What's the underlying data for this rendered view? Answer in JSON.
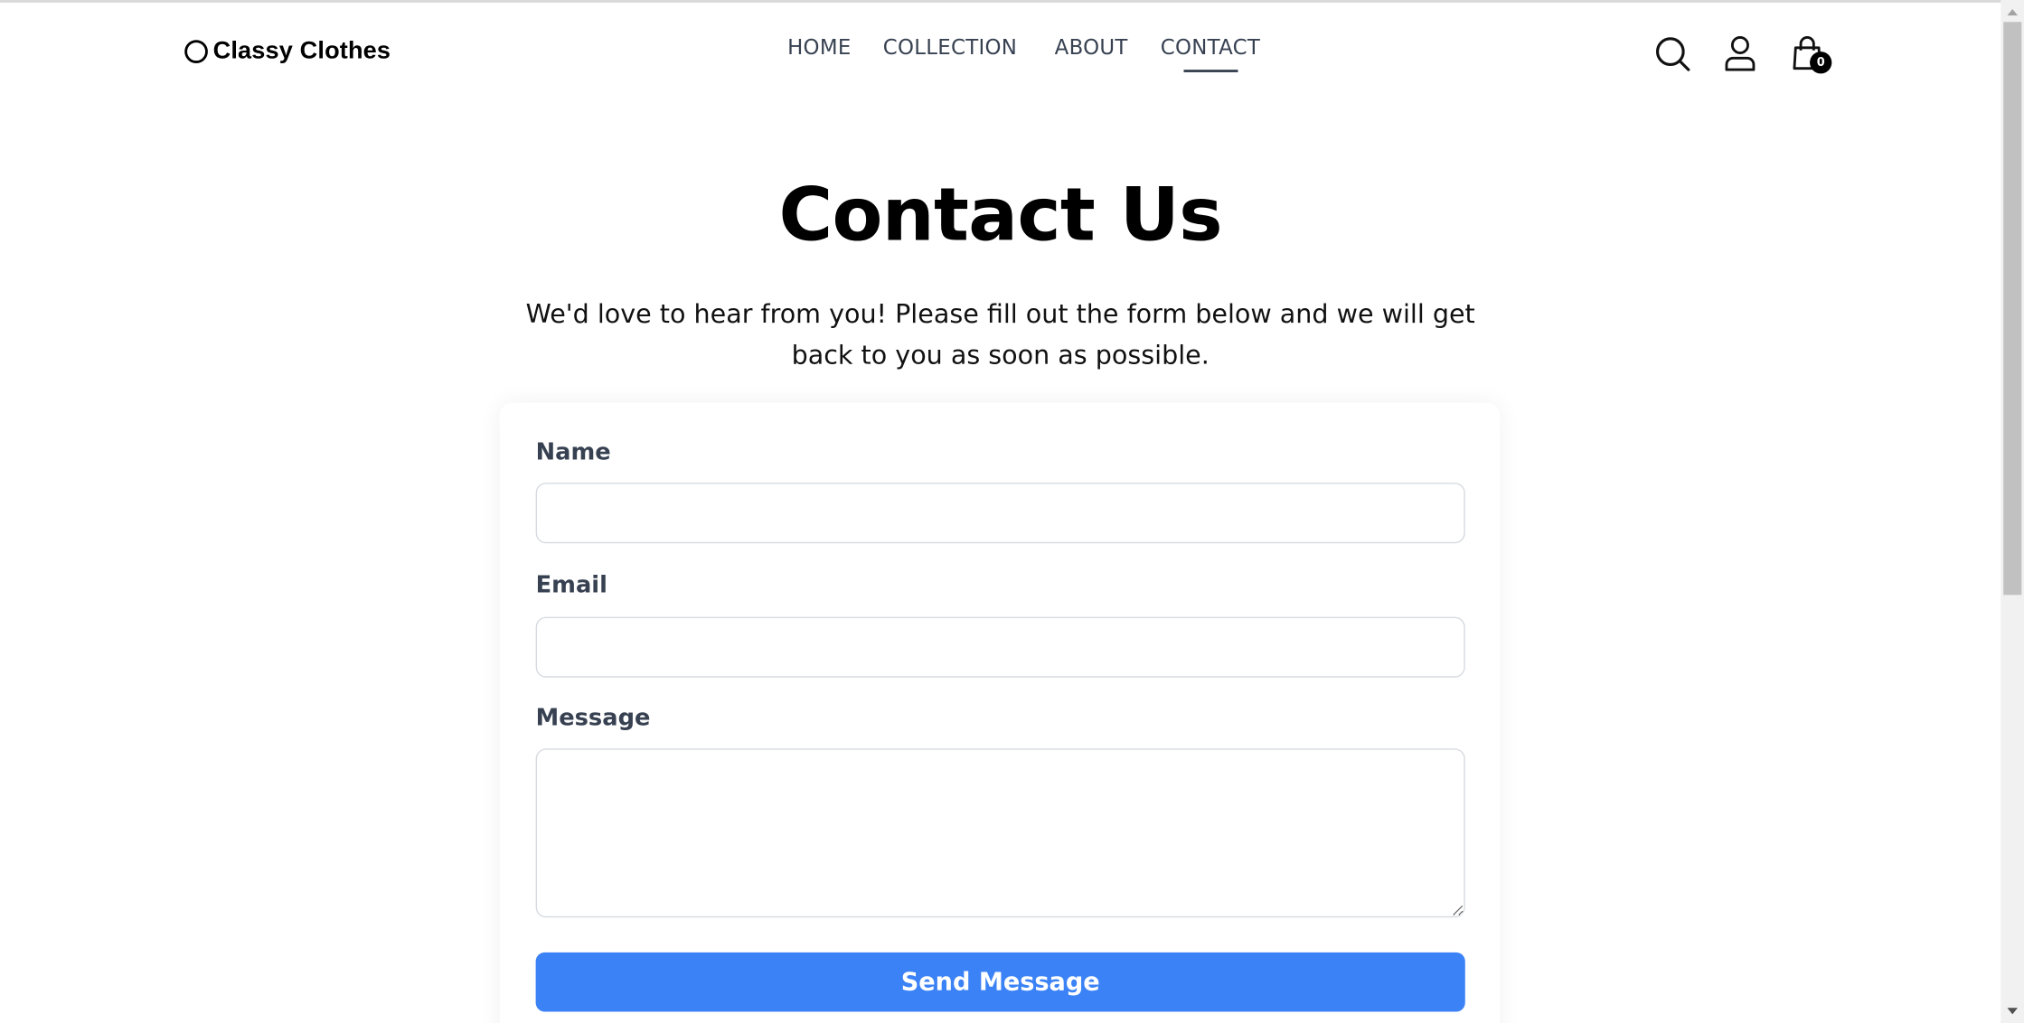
{
  "brand": {
    "name": "Classy Clothes"
  },
  "nav": {
    "items": [
      {
        "label": "HOME"
      },
      {
        "label": "COLLECTION"
      },
      {
        "label": "ABOUT"
      },
      {
        "label": "CONTACT",
        "active": true
      }
    ]
  },
  "header_icons": {
    "search": "search-icon",
    "account": "user-icon",
    "cart": "shopping-bag-icon",
    "cart_count": "0"
  },
  "page": {
    "title": "Contact Us",
    "intro": "We'd love to hear from you! Please fill out the form below and we will get back to you as soon as possible."
  },
  "form": {
    "name_label": "Name",
    "name_value": "",
    "email_label": "Email",
    "email_value": "",
    "message_label": "Message",
    "message_value": "",
    "submit_label": "Send Message"
  },
  "colors": {
    "accent": "#3b82f6",
    "label_text": "#374151",
    "heading_text": "#000000"
  }
}
